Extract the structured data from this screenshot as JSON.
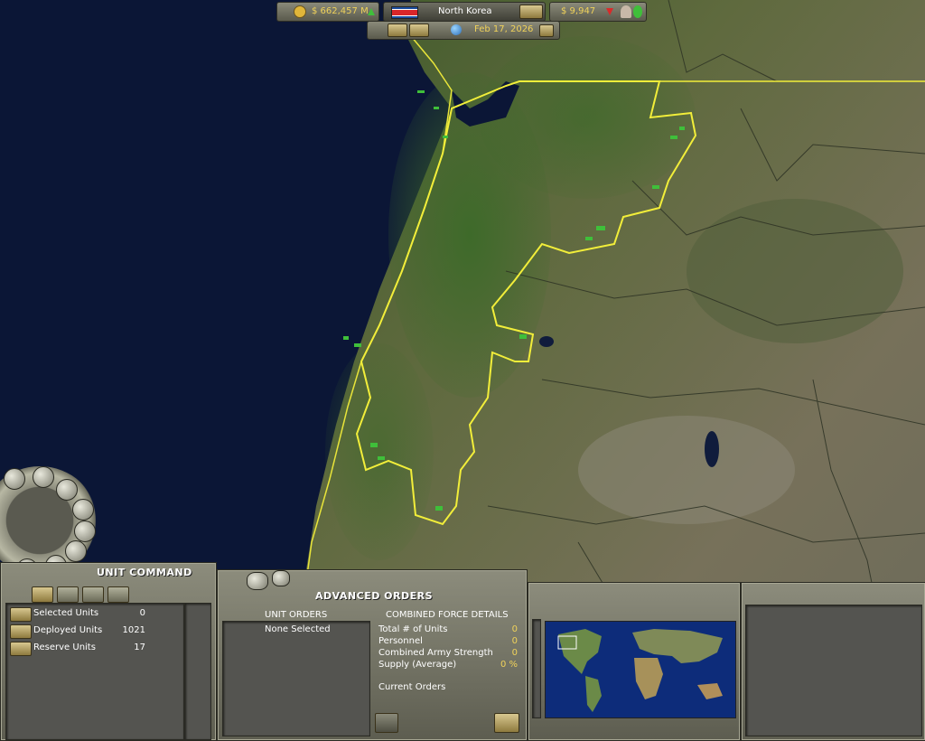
{
  "topbar": {
    "treasury": "$ 662,457 M",
    "country": "North Korea",
    "cash": "$ 9,947",
    "date": "Feb 17, 2026"
  },
  "unit_command": {
    "title": "UNIT COMMAND",
    "rows": [
      {
        "label": "Selected Units",
        "value": "0"
      },
      {
        "label": "Deployed Units",
        "value": "1021"
      },
      {
        "label": "Reserve Units",
        "value": "17"
      }
    ]
  },
  "advanced_orders": {
    "title": "ADVANCED ORDERS",
    "unit_orders_header": "UNIT ORDERS",
    "unit_orders_value": "None Selected",
    "details_header": "COMBINED FORCE DETAILS",
    "details": [
      {
        "label": "Total # of Units",
        "value": "0"
      },
      {
        "label": "Personnel",
        "value": "0"
      },
      {
        "label": "Combined Army Strength",
        "value": "0"
      },
      {
        "label": "Supply (Average)",
        "value": "0 %"
      }
    ],
    "current_orders_label": "Current Orders"
  },
  "colors": {
    "ocean": "#0b1636",
    "border_highlight": "#f2ee3a",
    "panel": "#7c7c6c",
    "accent_text": "#f0d25a"
  },
  "icons": [
    "treasury-icon",
    "flag-icon",
    "cash-icon",
    "pause-icon",
    "play-icon",
    "globe-icon",
    "cabinet-icon",
    "tank-icon",
    "minimap"
  ]
}
